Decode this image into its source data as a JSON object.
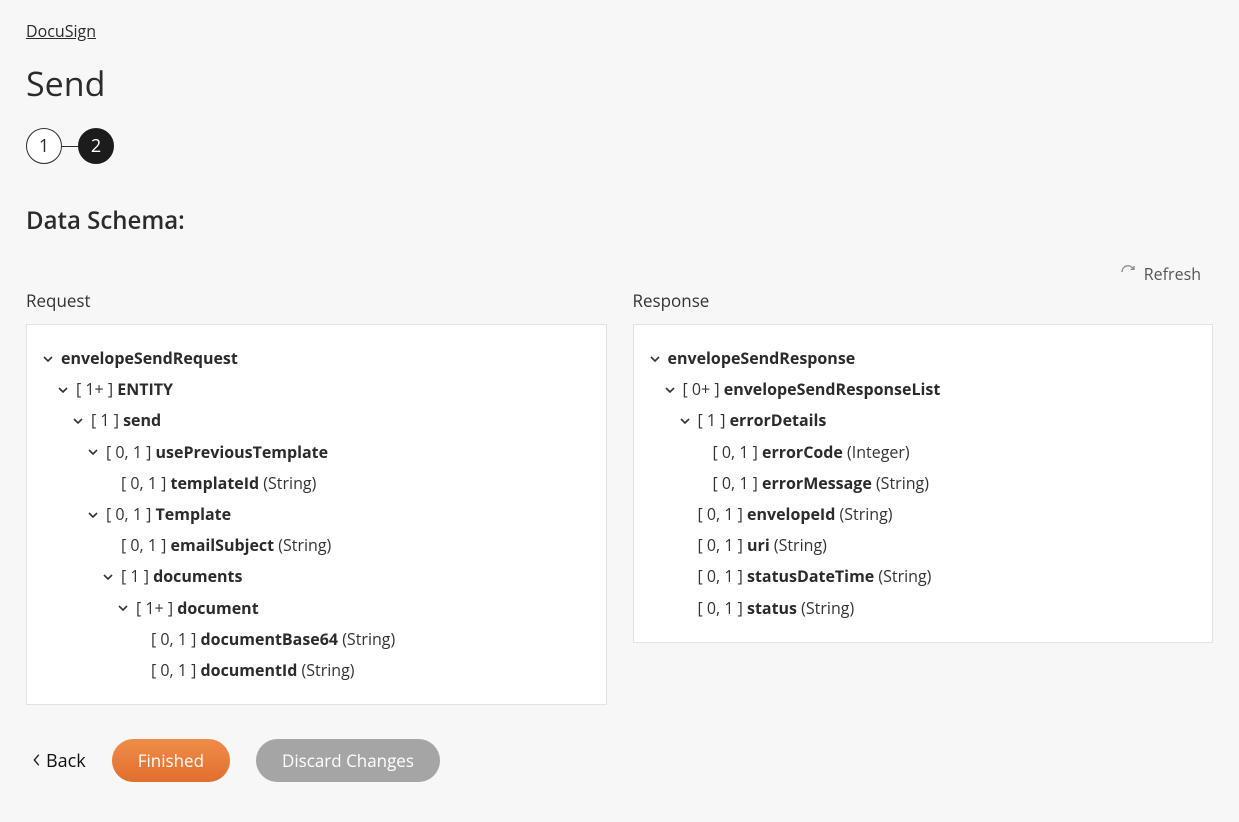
{
  "breadcrumb": {
    "label": "DocuSign"
  },
  "title": "Send",
  "steps": {
    "labels": [
      "1",
      "2"
    ],
    "active_index": 1
  },
  "section_heading": "Data Schema:",
  "refresh_label": "Refresh",
  "request": {
    "label": "Request",
    "tree": [
      {
        "expandable": true,
        "card": "",
        "name": "envelopeSendRequest",
        "type": "",
        "children": [
          {
            "expandable": true,
            "card": "[ 1+ ]",
            "name": "ENTITY",
            "type": "",
            "children": [
              {
                "expandable": true,
                "card": "[ 1 ]",
                "name": "send",
                "type": "",
                "children": [
                  {
                    "expandable": true,
                    "card": "[ 0, 1 ]",
                    "name": "usePreviousTemplate",
                    "type": "",
                    "children": [
                      {
                        "expandable": false,
                        "card": "[ 0, 1 ]",
                        "name": "templateId",
                        "type": "(String)"
                      }
                    ]
                  },
                  {
                    "expandable": true,
                    "card": "[ 0, 1 ]",
                    "name": "Template",
                    "type": "",
                    "children": [
                      {
                        "expandable": false,
                        "card": "[ 0, 1 ]",
                        "name": "emailSubject",
                        "type": "(String)"
                      },
                      {
                        "expandable": true,
                        "card": "[ 1 ]",
                        "name": "documents",
                        "type": "",
                        "children": [
                          {
                            "expandable": true,
                            "card": "[ 1+ ]",
                            "name": "document",
                            "type": "",
                            "children": [
                              {
                                "expandable": false,
                                "card": "[ 0, 1 ]",
                                "name": "documentBase64",
                                "type": "(String)"
                              },
                              {
                                "expandable": false,
                                "card": "[ 0, 1 ]",
                                "name": "documentId",
                                "type": "(String)"
                              }
                            ]
                          }
                        ]
                      }
                    ]
                  }
                ]
              }
            ]
          }
        ]
      }
    ]
  },
  "response": {
    "label": "Response",
    "tree": [
      {
        "expandable": true,
        "card": "",
        "name": "envelopeSendResponse",
        "type": "",
        "children": [
          {
            "expandable": true,
            "card": "[ 0+ ]",
            "name": "envelopeSendResponseList",
            "type": "",
            "children": [
              {
                "expandable": true,
                "card": "[ 1 ]",
                "name": "errorDetails",
                "type": "",
                "children": [
                  {
                    "expandable": false,
                    "card": "[ 0, 1 ]",
                    "name": "errorCode",
                    "type": "(Integer)"
                  },
                  {
                    "expandable": false,
                    "card": "[ 0, 1 ]",
                    "name": "errorMessage",
                    "type": "(String)"
                  }
                ]
              },
              {
                "expandable": false,
                "card": "[ 0, 1 ]",
                "name": "envelopeId",
                "type": "(String)"
              },
              {
                "expandable": false,
                "card": "[ 0, 1 ]",
                "name": "uri",
                "type": "(String)"
              },
              {
                "expandable": false,
                "card": "[ 0, 1 ]",
                "name": "statusDateTime",
                "type": "(String)"
              },
              {
                "expandable": false,
                "card": "[ 0, 1 ]",
                "name": "status",
                "type": "(String)"
              }
            ]
          }
        ]
      }
    ]
  },
  "footer": {
    "back_label": "Back",
    "finished_label": "Finished",
    "discard_label": "Discard Changes"
  }
}
